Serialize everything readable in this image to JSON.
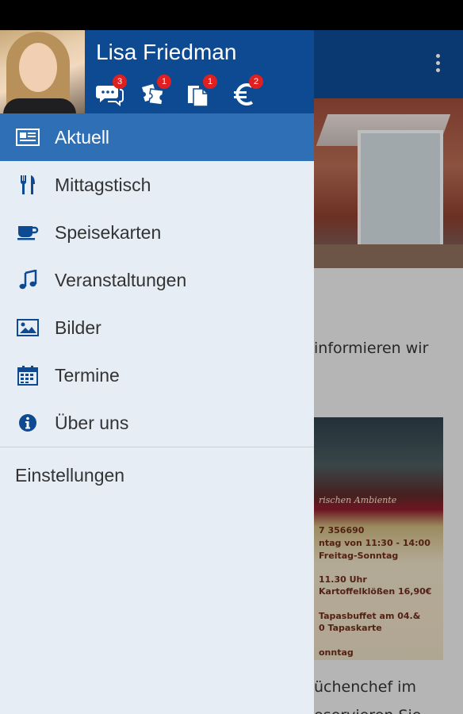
{
  "user": {
    "name": "Lisa Friedman"
  },
  "notifications": [
    {
      "icon": "chat-icon",
      "count": "3"
    },
    {
      "icon": "tickets-icon",
      "count": "1"
    },
    {
      "icon": "documents-icon",
      "count": "1"
    },
    {
      "icon": "euro-icon",
      "count": "2"
    }
  ],
  "nav": {
    "items": [
      {
        "label": "Aktuell",
        "icon": "newspaper-icon",
        "active": true
      },
      {
        "label": "Mittagstisch",
        "icon": "cutlery-icon"
      },
      {
        "label": "Speisekarten",
        "icon": "coffee-cup-icon"
      },
      {
        "label": "Veranstaltungen",
        "icon": "music-note-icon"
      },
      {
        "label": "Bilder",
        "icon": "image-icon"
      },
      {
        "label": "Termine",
        "icon": "calendar-icon"
      },
      {
        "label": "Über uns",
        "icon": "info-icon"
      }
    ],
    "settings_label": "Einstellungen"
  },
  "background": {
    "text_1": "informieren wir",
    "promo_lines": [
      "rischen Ambiente",
      "7 356690",
      "ntag von 11:30 - 14:00",
      "Freitag-Sonntag",
      "11.30 Uhr",
      "Kartoffelklößen 16,90€",
      "Tapasbuffet am 04.&",
      "0 Tapaskarte",
      "onntag"
    ],
    "text_2a": "üchenchef im",
    "text_2b": "eservieren Sie"
  },
  "colors": {
    "primary": "#0d4a92",
    "active": "#2f6fb5",
    "drawer_bg": "#e6edf5",
    "badge": "#e02020"
  }
}
